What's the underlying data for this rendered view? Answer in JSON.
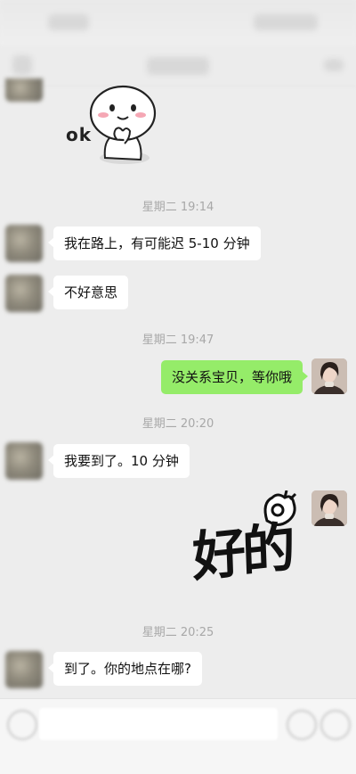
{
  "messages": [
    {
      "type": "sticker",
      "side": "left",
      "sticker_text": "ok"
    },
    {
      "type": "time",
      "text": "星期二 19:14"
    },
    {
      "type": "text",
      "side": "left",
      "text": "我在路上，有可能迟 5-10 分钟"
    },
    {
      "type": "text",
      "side": "left",
      "text": "不好意思"
    },
    {
      "type": "time",
      "text": "星期二 19:47"
    },
    {
      "type": "text",
      "side": "right",
      "text": "没关系宝贝，等你哦"
    },
    {
      "type": "time",
      "text": "星期二 20:20"
    },
    {
      "type": "text",
      "side": "left",
      "text": "我要到了。10 分钟"
    },
    {
      "type": "sticker",
      "side": "right",
      "sticker_text": "好的"
    },
    {
      "type": "time",
      "text": "星期二 20:25"
    },
    {
      "type": "text",
      "side": "left",
      "text": "到了。你的地点在哪?"
    }
  ],
  "colors": {
    "background": "#ededed",
    "sent_bubble": "#95ec69",
    "received_bubble": "#ffffff",
    "timestamp": "#a8a8a8"
  }
}
